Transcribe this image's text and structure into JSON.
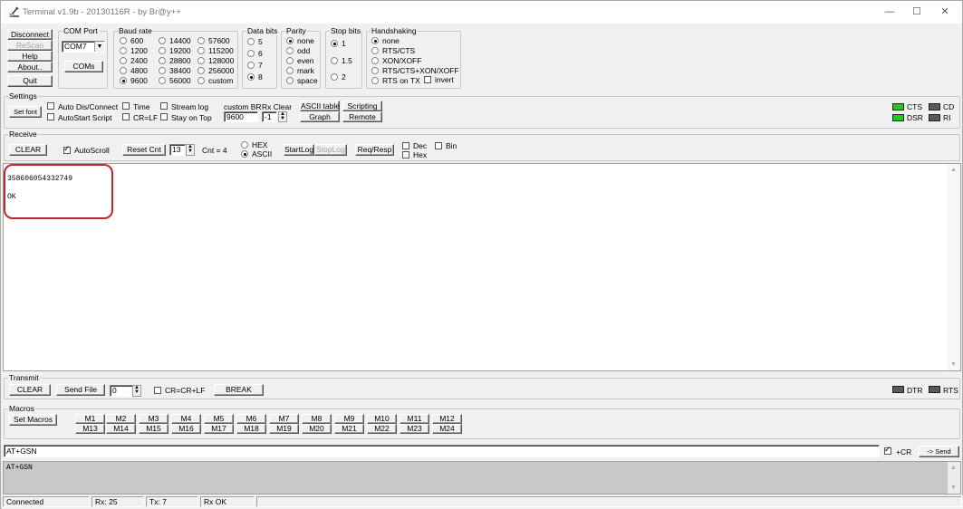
{
  "window": {
    "title": "Terminal v1.9b - 20130116R - by Br@y++",
    "minimize": "—",
    "maximize": "☐",
    "close": "✕"
  },
  "left_buttons": {
    "disconnect": "Disconnect",
    "rescan": "ReScan",
    "help": "Help",
    "about": "About..",
    "quit": "Quit"
  },
  "com_port": {
    "label": "COM Port",
    "value": "COM7",
    "coms_button": "COMs"
  },
  "baud_rate": {
    "label": "Baud rate",
    "options": [
      "600",
      "1200",
      "2400",
      "4800",
      "9600",
      "14400",
      "19200",
      "28800",
      "38400",
      "56000",
      "57600",
      "115200",
      "128000",
      "256000",
      "custom"
    ],
    "selected": "9600"
  },
  "data_bits": {
    "label": "Data bits",
    "options": [
      "5",
      "6",
      "7",
      "8"
    ],
    "selected": "8"
  },
  "parity": {
    "label": "Parity",
    "options": [
      "none",
      "odd",
      "even",
      "mark",
      "space"
    ],
    "selected": "none"
  },
  "stop_bits": {
    "label": "Stop bits",
    "options": [
      "1",
      "1.5",
      "2"
    ],
    "selected": "1"
  },
  "handshaking": {
    "label": "Handshaking",
    "options": [
      "none",
      "RTS/CTS",
      "XON/XOFF",
      "RTS/CTS+XON/XOFF",
      "RTS on TX"
    ],
    "selected": "none",
    "invert": "invert"
  },
  "settings": {
    "label": "Settings",
    "set_font": "Set font",
    "auto_dis_connect": "Auto Dis/Connect",
    "autostart_script": "AutoStart Script",
    "time": "Time",
    "cr_lf": "CR=LF",
    "stream_log": "Stream log",
    "stay_on_top": "Stay on Top",
    "custom_br_label": "custom BR",
    "custom_br_value": "9600",
    "rx_clear_label": "Rx Clear",
    "rx_clear_value": "-1",
    "ascii_table": "ASCII table",
    "graph": "Graph",
    "scripting": "Scripting",
    "remote": "Remote"
  },
  "indicators": {
    "cts": "CTS",
    "cd": "CD",
    "dsr": "DSR",
    "ri": "RI",
    "dtr": "DTR",
    "rts": "RTS",
    "led_on_color": "#22c822",
    "led_off_color": "#5a5a5a"
  },
  "receive": {
    "label": "Receive",
    "clear": "CLEAR",
    "autoscroll": "AutoScroll",
    "reset_cnt": "Reset Cnt",
    "cnt_spin": "13",
    "cnt_label": "Cnt = 4",
    "hex": "HEX",
    "ascii": "ASCII",
    "mode_selected": "ASCII",
    "startlog": "StartLog",
    "stoplog": "StopLog",
    "req_resp": "Req/Resp",
    "dec": "Dec",
    "hex_chk": "Hex",
    "bin": "Bin",
    "lines": [
      "358606054332749",
      "OK"
    ]
  },
  "transmit": {
    "label": "Transmit",
    "clear": "CLEAR",
    "send_file": "Send File",
    "file_spin": "0",
    "cr_crlf": "CR=CR+LF",
    "break": "BREAK"
  },
  "macros": {
    "label": "Macros",
    "set_macros": "Set Macros",
    "row1": [
      "M1",
      "M2",
      "M3",
      "M4",
      "M5",
      "M6",
      "M7",
      "M8",
      "M9",
      "M10",
      "M11",
      "M12"
    ],
    "row2": [
      "M13",
      "M14",
      "M15",
      "M16",
      "M17",
      "M18",
      "M19",
      "M20",
      "M21",
      "M22",
      "M23",
      "M24"
    ]
  },
  "send_bar": {
    "input_value": "AT+GSN",
    "plus_cr": "+CR",
    "send": "-> Send"
  },
  "transmit_history": {
    "text": "AT+GSN"
  },
  "status_bar": {
    "connection": "Connected",
    "rx": "Rx: 25",
    "tx": "Tx: 7",
    "rx_status": "Rx OK"
  },
  "highlight_color": "#c0272d"
}
